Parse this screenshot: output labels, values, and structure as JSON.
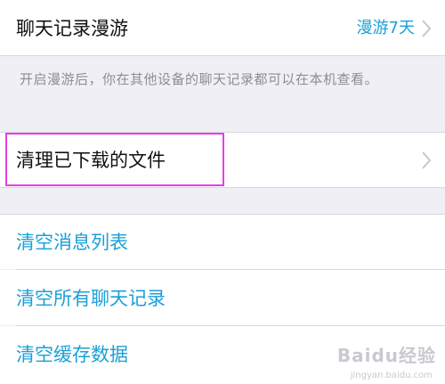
{
  "roaming": {
    "label": "聊天记录漫游",
    "value": "漫游7天",
    "footer": "开启漫游后，你在其他设备的聊天记录都可以在本机查看。"
  },
  "downloads": {
    "label": "清理已下载的文件"
  },
  "actions": [
    {
      "label": "清空消息列表"
    },
    {
      "label": "清空所有聊天记录"
    },
    {
      "label": "清空缓存数据"
    }
  ],
  "watermark": {
    "brand": "Baidu经验",
    "url": "jingyan.baidu.com"
  },
  "colors": {
    "accent": "#1aa0d8",
    "highlight": "#e63fe8",
    "background": "#f0eff5"
  }
}
